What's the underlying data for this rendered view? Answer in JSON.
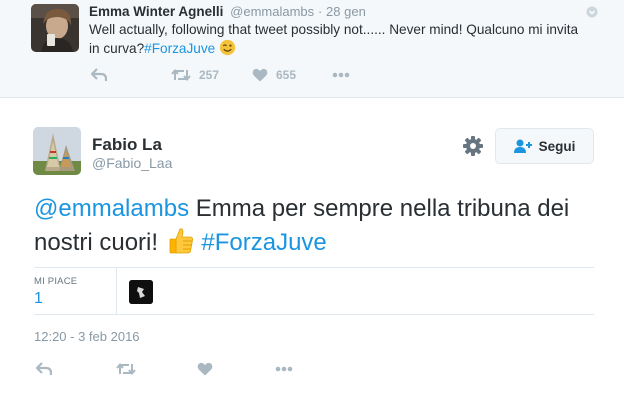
{
  "parent_tweet": {
    "author_name": "Emma Winter Agnelli",
    "author_handle": "@emmalambs",
    "separator": "·",
    "date": "28 gen",
    "text_before_link": "Well actually, following that tweet possibly not...... Never mind! Qualcuno mi invita in curva?",
    "hashtag": "#ForzaJuve",
    "emoji": "😉",
    "retweet_count": "257",
    "like_count": "655"
  },
  "main_tweet": {
    "author_name": "Fabio La",
    "author_handle": "@Fabio_Laa",
    "follow_label": "Segui",
    "mention": "@emmalambs",
    "text": " Emma per sempre nella tribuna dei nostri cuori! ",
    "hashtag": "#ForzaJuve",
    "likes_label": "MI PIACE",
    "likes_count": "1",
    "timestamp": "12:20 - 3 feb 2016"
  },
  "colors": {
    "link": "#1b95e0",
    "action_icon": "#aab8c2",
    "parent_bg": "#f5f8fa"
  },
  "icons": [
    "caret-down-icon",
    "reply-icon",
    "retweet-icon",
    "heart-icon",
    "more-icon",
    "gear-icon",
    "follow-user-icon",
    "thumbs-up-emoji",
    "winking-face-emoji"
  ]
}
